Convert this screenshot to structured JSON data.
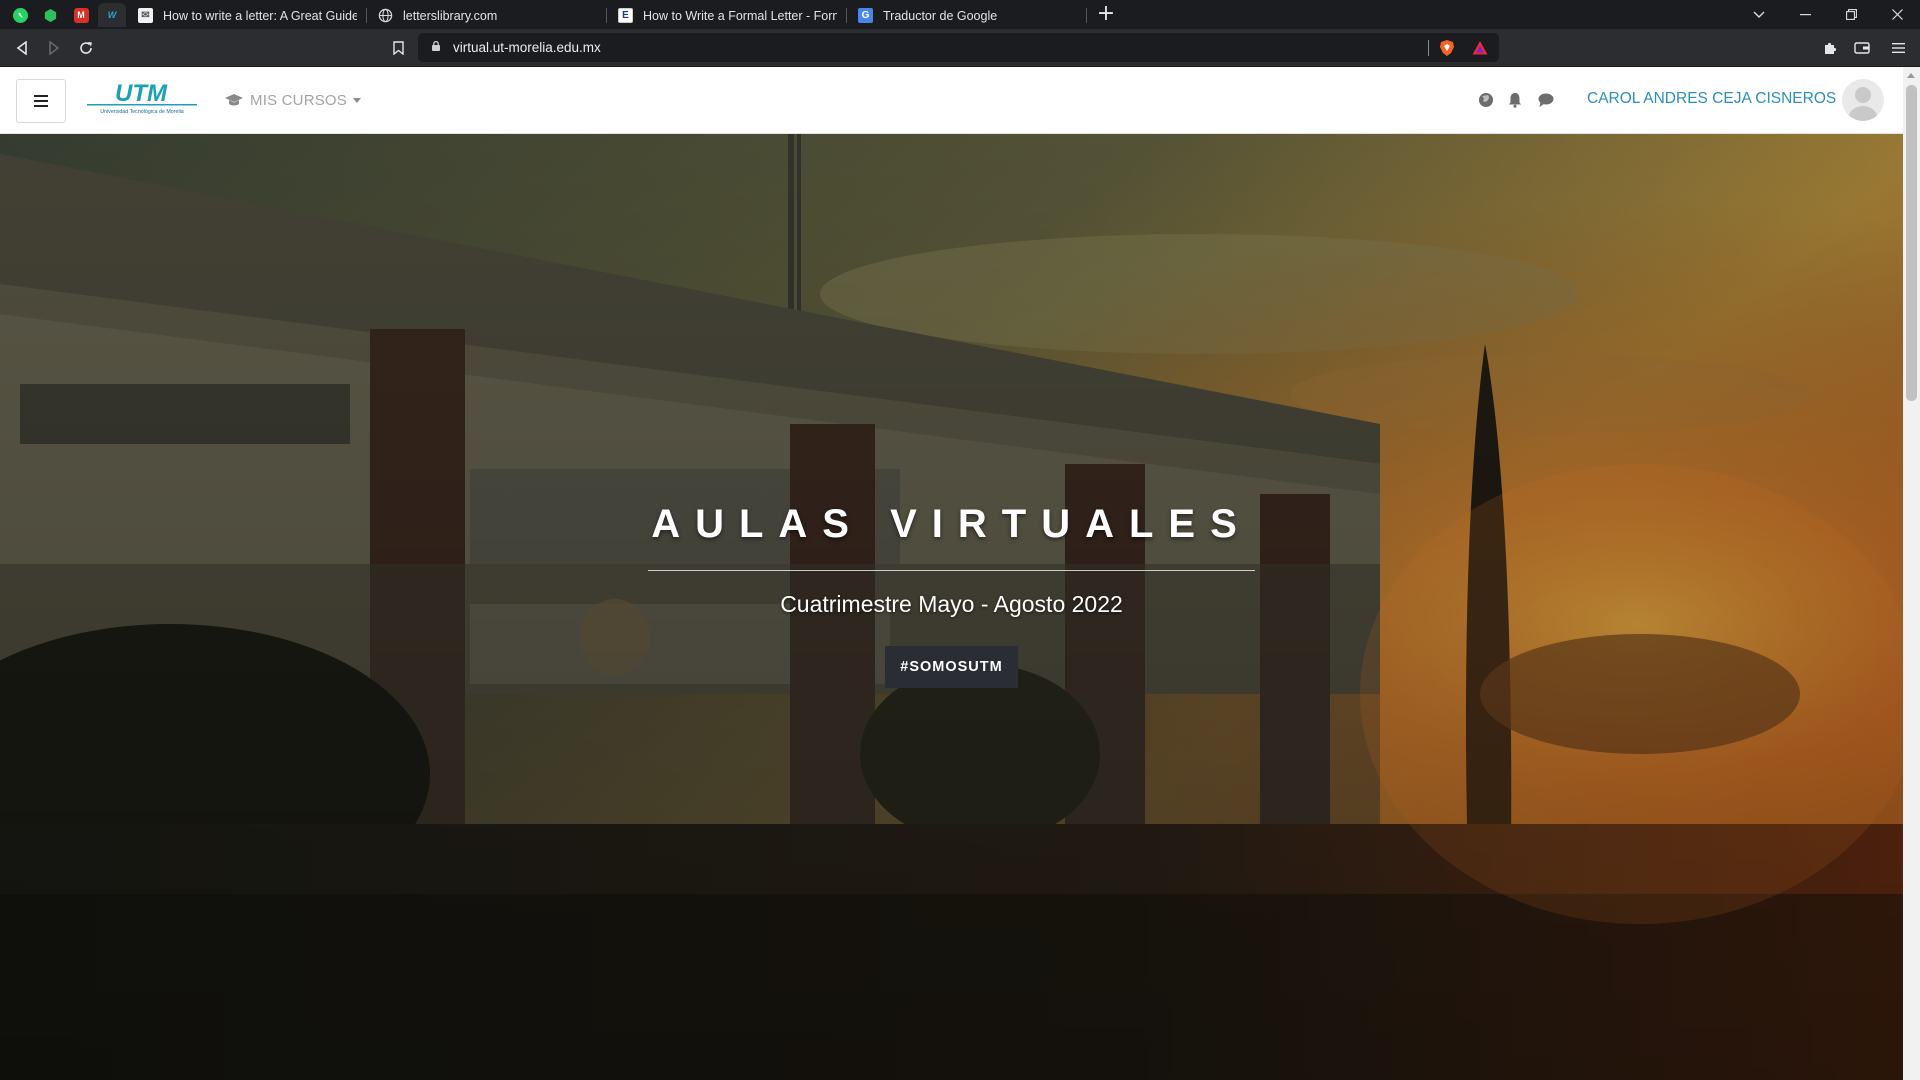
{
  "browser": {
    "pinned_tabs": [
      {
        "icon": "whatsapp-icon",
        "color": "#25d366"
      },
      {
        "icon": "hexagon-extension-icon",
        "color": "#2fbf5b"
      },
      {
        "icon": "gmail-icon",
        "color": "#d93025"
      },
      {
        "icon": "utm-site-icon",
        "color": "#2aa6c6"
      }
    ],
    "tabs": [
      {
        "title": "How to write a letter: A Great Guide fo",
        "icon": "letter-guide-favicon"
      },
      {
        "title": "letterslibrary.com",
        "icon": "globe-icon"
      },
      {
        "title": "How to Write a Formal Letter - Format",
        "icon": "document-favicon"
      },
      {
        "title": "Traductor de Google",
        "icon": "google-translate-favicon"
      }
    ],
    "new_tab_label": "+",
    "url": "virtual.ut-morelia.edu.mx"
  },
  "navbar": {
    "logo_text": "UTM",
    "logo_subtext": "Universidad Tecnológica de Morelia",
    "menu_label": "MIS CURSOS",
    "user_name": "CAROL ANDRES CEJA CISNEROS"
  },
  "hero": {
    "title": "AULAS VIRTUALES",
    "subtitle": "Cuatrimestre Mayo - Agosto 2022",
    "button_label": "#SOMOSUTM"
  },
  "colors": {
    "accent": "#2a8fbd",
    "logo": "#1aa0b8",
    "hero_button": "#2a2d33"
  }
}
